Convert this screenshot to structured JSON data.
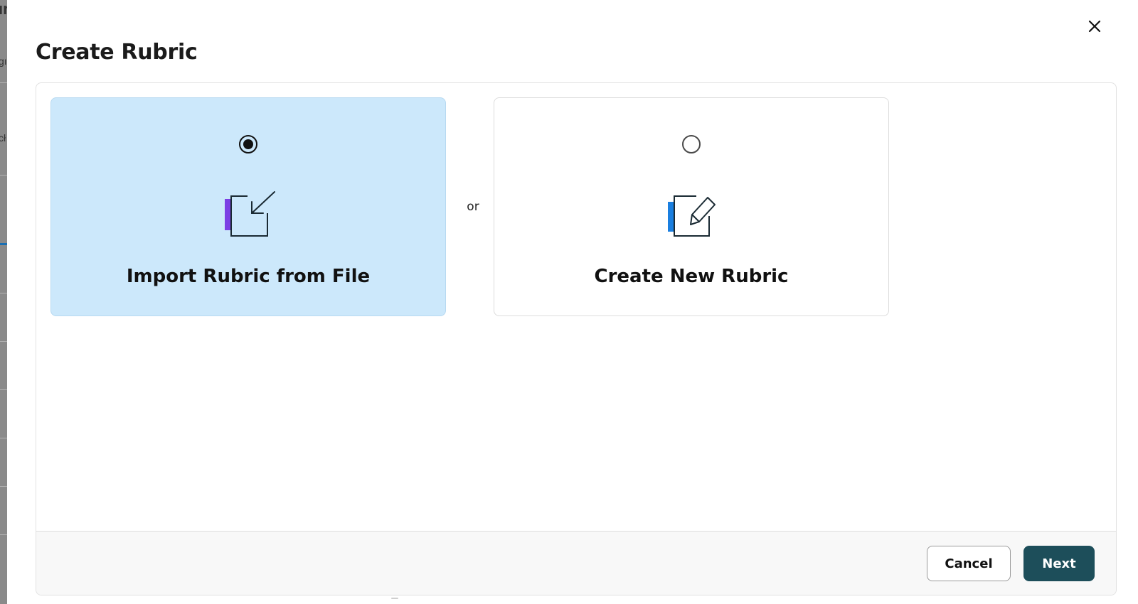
{
  "dialog": {
    "title": "Create Rubric",
    "close_icon": "close-icon"
  },
  "options": [
    {
      "label": "Import Rubric from File",
      "selected": true,
      "icon": "import-file-icon",
      "accent_color": "#7b3fe4"
    },
    {
      "label": "Create New Rubric",
      "selected": false,
      "icon": "edit-document-icon",
      "accent_color": "#1a7fe0"
    }
  ],
  "separator_text": "or",
  "footer": {
    "cancel_label": "Cancel",
    "next_label": "Next"
  },
  "colors": {
    "selected_card_bg": "#cce8fb",
    "primary_button": "#1d4e5a"
  }
}
